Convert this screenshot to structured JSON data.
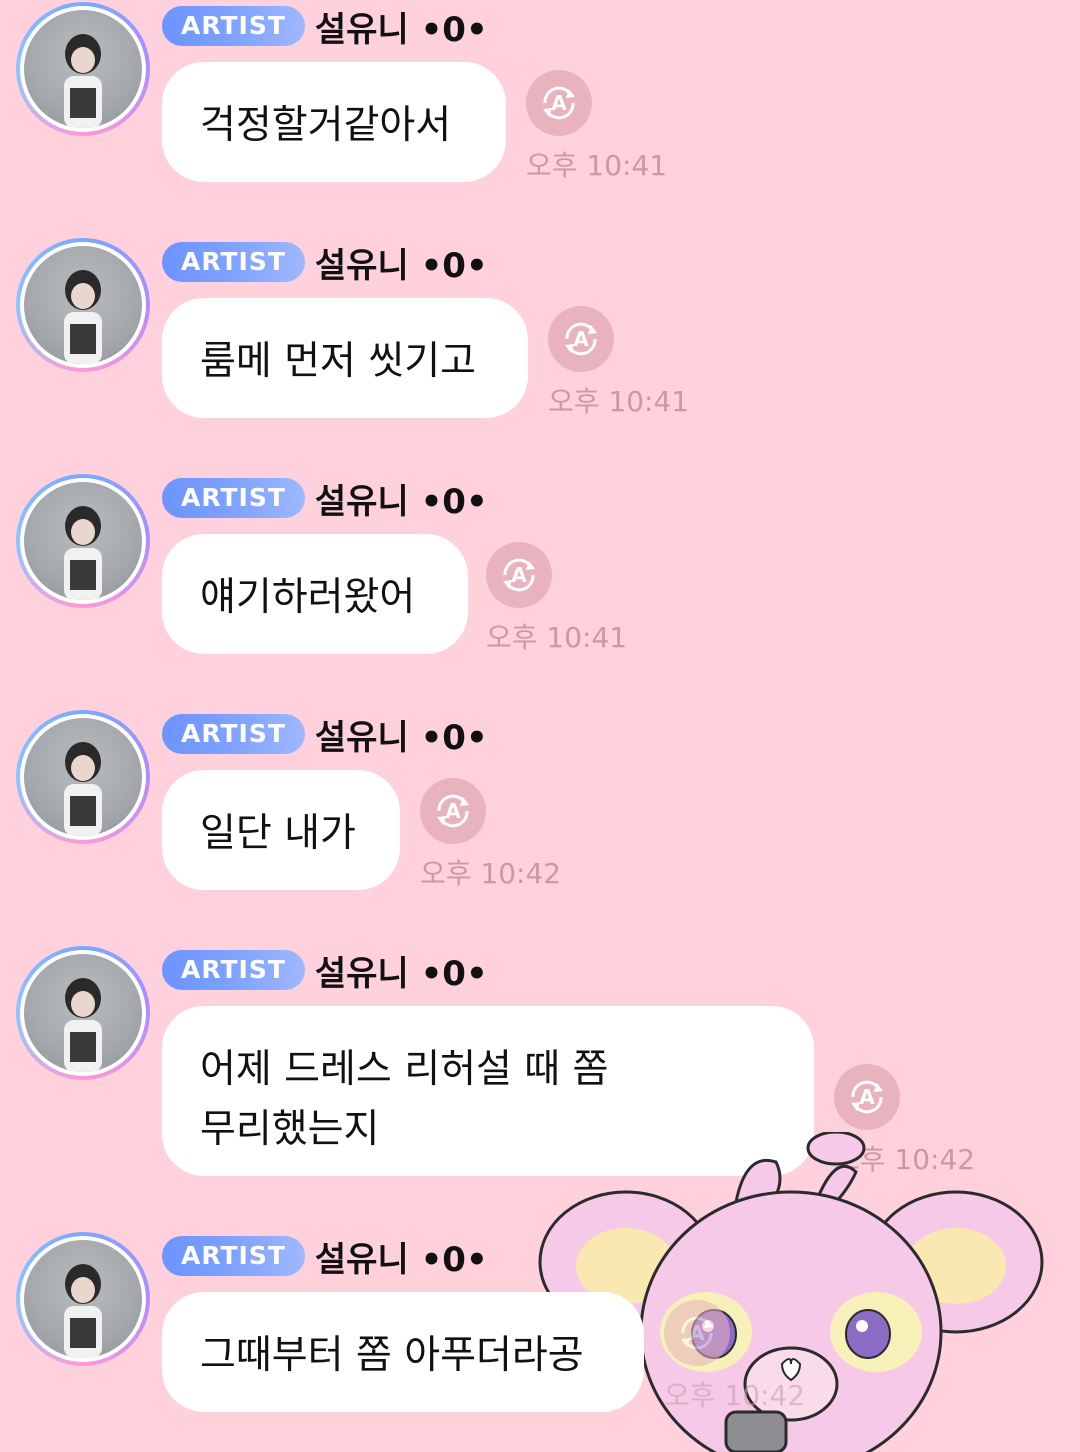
{
  "messages": [
    {
      "badge": "ARTIST",
      "sender": "설유니 •0•",
      "text": "걱정할거같아서",
      "time": "오후 10:41"
    },
    {
      "badge": "ARTIST",
      "sender": "설유니 •0•",
      "text": "룸메 먼저 씻기고",
      "time": "오후 10:41"
    },
    {
      "badge": "ARTIST",
      "sender": "설유니 •0•",
      "text": "얘기하러왔어",
      "time": "오후 10:41"
    },
    {
      "badge": "ARTIST",
      "sender": "설유니 •0•",
      "text": "일단 내가",
      "time": "오후 10:42"
    },
    {
      "badge": "ARTIST",
      "sender": "설유니 •0•",
      "text": "어제 드레스 리허설 때 쫌\n무리했는지",
      "time": "오후 10:42"
    },
    {
      "badge": "ARTIST",
      "sender": "설유니 •0•",
      "text": "그때부터 쫌 아푸더라공",
      "time": "오후 10:42"
    }
  ],
  "icons": {
    "translate": "translate-a-icon",
    "sticker": "pink-bear-sticker"
  },
  "colors": {
    "background": "#ffd1dc",
    "badge": "#7aa0ff",
    "bubble": "#ffffff",
    "time": "#c79ba6",
    "translate_button": "#e8b3bf"
  }
}
